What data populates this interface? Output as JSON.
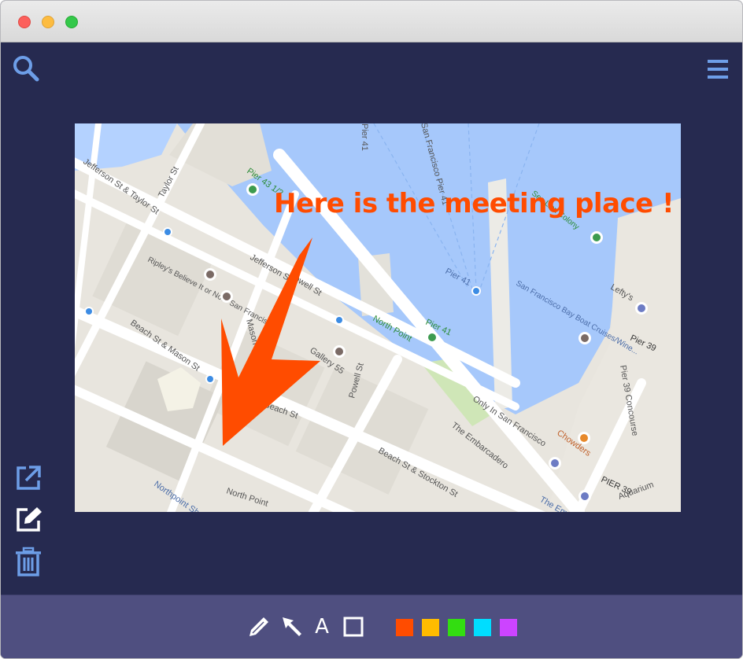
{
  "window": {
    "traffic_lights": {
      "close": "#fc605c",
      "minimize": "#fdbc40",
      "maximize": "#34c84a"
    }
  },
  "header": {
    "search_icon": "search-icon",
    "menu_icon": "hamburger-menu-icon",
    "icon_color": "#6d9ee8"
  },
  "side_tools": [
    {
      "icon": "share-external-icon"
    },
    {
      "icon": "edit-note-icon"
    },
    {
      "icon": "trash-icon"
    }
  ],
  "canvas": {
    "annotation_text": "Here is the meeting place !",
    "annotation_color": "#ff4c00",
    "map_labels": {
      "pier_41_top": "Pier 41",
      "san_francisco_pier_41": "San Francisco Pier 41",
      "pier_43": "Pier 43 1/2",
      "jefferson_taylor": "Jefferson St & Taylor St",
      "taylor_st": "Taylor St",
      "jefferson_st": "Jefferson St",
      "ripley": "Ripley's Believe It or Not - San Francisco",
      "powell_st_stop": "Powell St",
      "north_point": "North Point",
      "pier_41_green": "Pier 41",
      "pier_41_dock": "Pier 41",
      "sf_bay_boat": "San Francisco Bay Boat Cruises/Wine...",
      "sea_lion_colony": "Sea Lion Colony",
      "leftys": "Lefty's",
      "pier_39": "Pier 39",
      "pier_39_concourse": "Pier 39 Concourse",
      "beach_mason": "Beach St & Mason St",
      "mason_st": "Mason St",
      "gallery_55": "Gallery 55",
      "beach_st": "Beach St",
      "powell_st": "Powell St",
      "only_in_sf": "Only In San Francisco",
      "the_embarcadero": "The Embarcadero",
      "chowders": "Chowders",
      "beach_stockton": "Beach St & Stockton St",
      "pier_39_caps": "PIER 39",
      "aquarium": "Aquarium",
      "north_point_st": "North Point",
      "northpoint_shopping": "Northpoint Shopping",
      "the_em": "The Em"
    }
  },
  "toolbar": {
    "tools": [
      {
        "icon": "pencil-icon"
      },
      {
        "icon": "arrow-pointer-icon"
      },
      {
        "icon": "text-tool-icon",
        "label": "A"
      },
      {
        "icon": "rectangle-icon"
      }
    ],
    "colors": [
      "#ff4c00",
      "#ffbb00",
      "#33dd11",
      "#00ddff",
      "#cc44ff"
    ]
  }
}
